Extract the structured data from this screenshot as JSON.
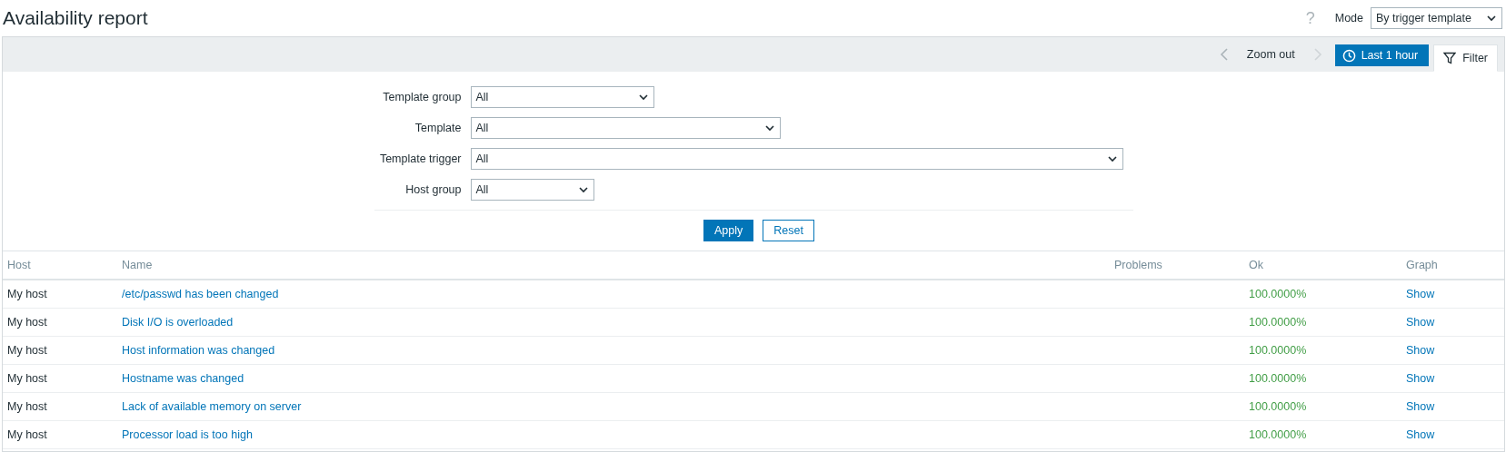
{
  "header": {
    "title": "Availability report",
    "help": "?",
    "mode_label": "Mode",
    "mode_value": "By trigger template"
  },
  "time_bar": {
    "zoom_out": "Zoom out",
    "period": "Last 1 hour",
    "filter_tab": {
      "label": "Filter",
      "expanded": true
    }
  },
  "filter": {
    "fields": [
      {
        "label": "Template group",
        "value": "All"
      },
      {
        "label": "Template",
        "value": "All"
      },
      {
        "label": "Template trigger",
        "value": "All"
      },
      {
        "label": "Host group",
        "value": "All"
      }
    ],
    "buttons": [
      {
        "label": "Apply",
        "kind": "primary"
      },
      {
        "label": "Reset",
        "kind": "secondary"
      }
    ]
  },
  "table": {
    "columns": [
      "Host",
      "Name",
      "Problems",
      "Ok",
      "Graph"
    ],
    "rows": [
      {
        "host": "My host",
        "name": "/etc/passwd has been changed",
        "ok": "100.0000%",
        "graph": "Show"
      },
      {
        "host": "My host",
        "name": "Disk I/O is overloaded",
        "ok": "100.0000%",
        "graph": "Show"
      },
      {
        "host": "My host",
        "name": "Host information was changed",
        "ok": "100.0000%",
        "graph": "Show"
      },
      {
        "host": "My host",
        "name": "Hostname was changed",
        "ok": "100.0000%",
        "graph": "Show"
      },
      {
        "host": "My host",
        "name": "Lack of available memory on server",
        "ok": "100.0000%",
        "graph": "Show"
      },
      {
        "host": "My host",
        "name": "Processor load is too high",
        "ok": "100.0000%",
        "graph": "Show"
      }
    ]
  }
}
